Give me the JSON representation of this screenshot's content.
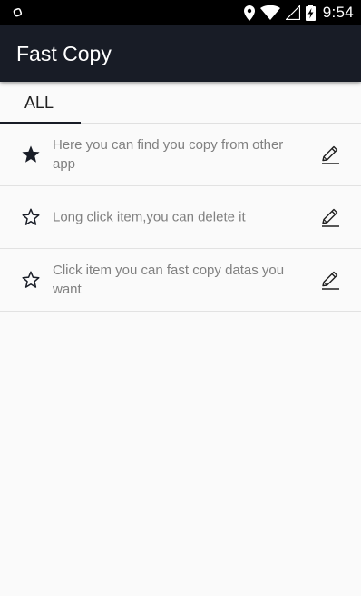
{
  "status_bar": {
    "time": "9:54",
    "icons": [
      "sync-icon",
      "location-icon",
      "wifi-icon",
      "signal-icon",
      "battery-charging-icon"
    ]
  },
  "app_bar": {
    "title": "Fast Copy",
    "background": "#181c26"
  },
  "tabs": [
    {
      "label": "ALL",
      "selected": true
    }
  ],
  "items": [
    {
      "text": "Here you can find you copy from other app",
      "starred": true
    },
    {
      "text": "Long click item,you can delete it",
      "starred": false
    },
    {
      "text": "Click item you can fast copy datas you want",
      "starred": false
    }
  ]
}
